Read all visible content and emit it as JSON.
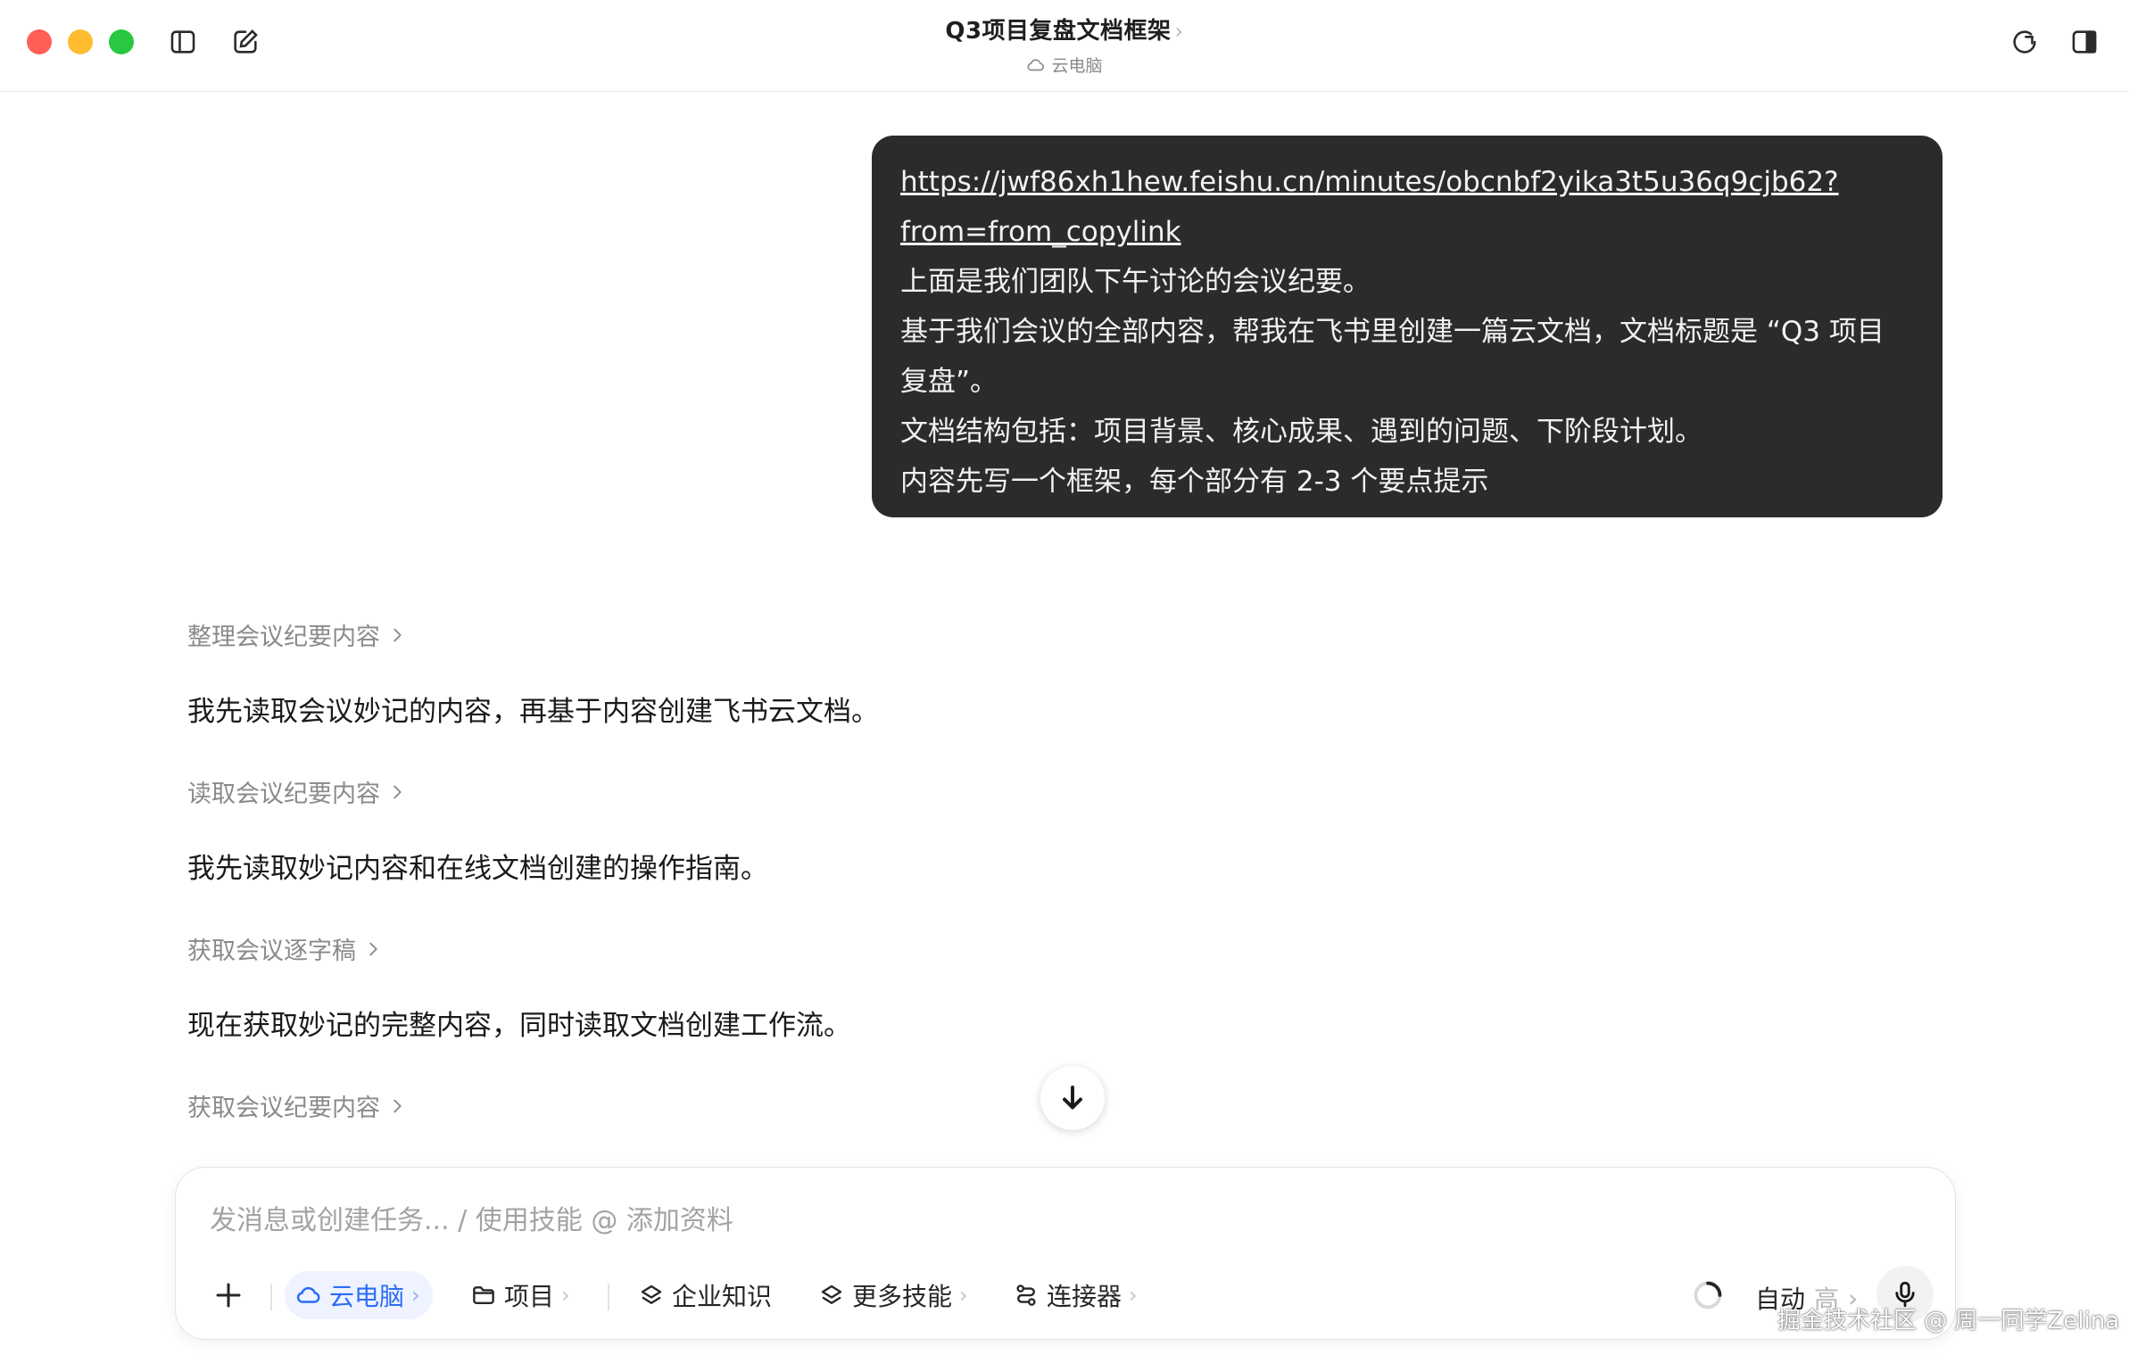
{
  "window": {
    "title": "Q3项目复盘文档框架",
    "title_chevron": "›",
    "subtitle": "云电脑"
  },
  "user_message": {
    "link_line1": "https://jwf86xh1hew.feishu.cn/minutes/obcnbf2yika3t5u36q9cjb62?",
    "link_line2": "from=from_copylink",
    "lines": [
      "上面是我们团队下午讨论的会议纪要。",
      "基于我们会议的全部内容，帮我在飞书里创建一篇云文档，文档标题是 “Q3 项目",
      "复盘”。",
      "文档结构包括：项目背景、核心成果、遇到的问题、下阶段计划。",
      "内容先写一个框架，每个部分有 2-3 个要点提示"
    ]
  },
  "assistant": {
    "steps": [
      "整理会议纪要内容",
      "读取会议纪要内容",
      "获取会议逐字稿",
      "获取会议纪要内容"
    ],
    "messages": [
      "我先读取会议妙记的内容，再基于内容创建飞书云文档。",
      "我先读取妙记内容和在线文档创建的操作指南。",
      "现在获取妙记的完整内容，同时读取文档创建工作流。"
    ]
  },
  "composer": {
    "placeholder": "发消息或创建任务... / 使用技能 @ 添加资料",
    "tools": {
      "cloud_pc": "云电脑",
      "project": "项目",
      "enterprise_knowledge": "企业知识",
      "more_skills": "更多技能",
      "connectors": "连接器"
    },
    "chevron": "›",
    "mode": "自动",
    "mode_level": "高"
  },
  "watermark": "掘金技术社区 @ 周一同学Zelina",
  "colors": {
    "accent": "#2d6df6",
    "bubble": "#2b2b2d",
    "traffic_red": "#ff5f57",
    "traffic_yellow": "#febc2e",
    "traffic_green": "#28c840"
  },
  "icons": [
    "sidebar-toggle-icon",
    "compose-icon",
    "cloud-icon",
    "history-icon",
    "panel-right-icon",
    "chevron-right-icon",
    "arrow-down-icon",
    "plus-icon",
    "folder-icon",
    "layers-icon",
    "connector-icon",
    "spinner-icon",
    "microphone-icon"
  ]
}
